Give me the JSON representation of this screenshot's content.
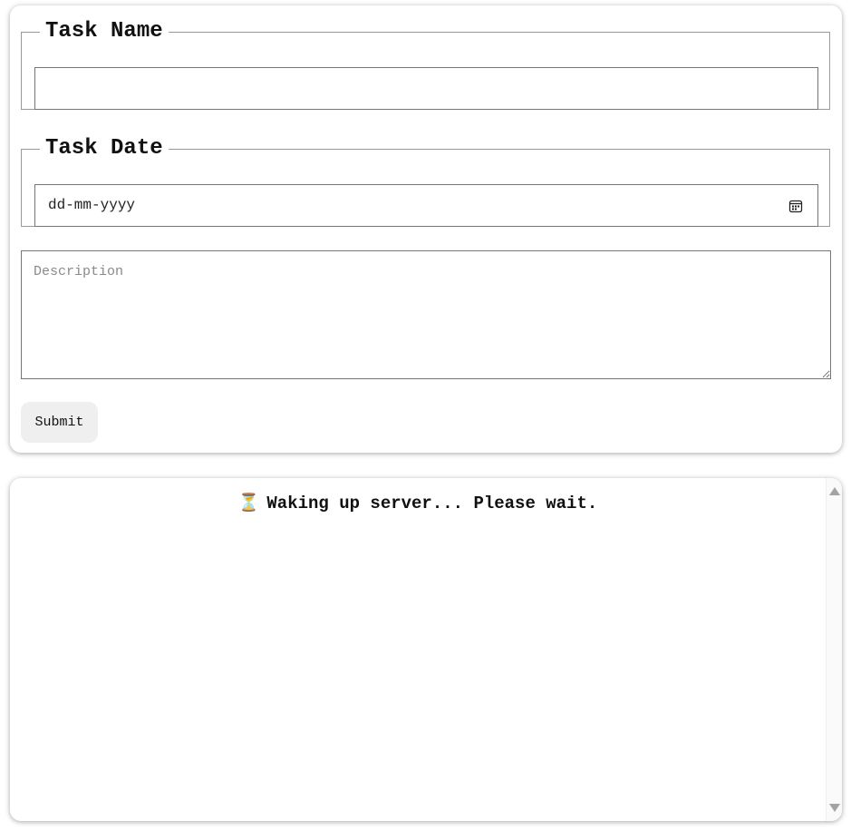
{
  "form": {
    "task_name": {
      "legend": "Task Name",
      "value": ""
    },
    "task_date": {
      "legend": "Task Date",
      "placeholder": "dd-mm-yyyy",
      "icon": "calendar-icon"
    },
    "description": {
      "placeholder": "Description",
      "value": ""
    },
    "submit_label": "Submit"
  },
  "output": {
    "status_icon": "⏳",
    "status_text": "Waking up server... Please wait."
  }
}
